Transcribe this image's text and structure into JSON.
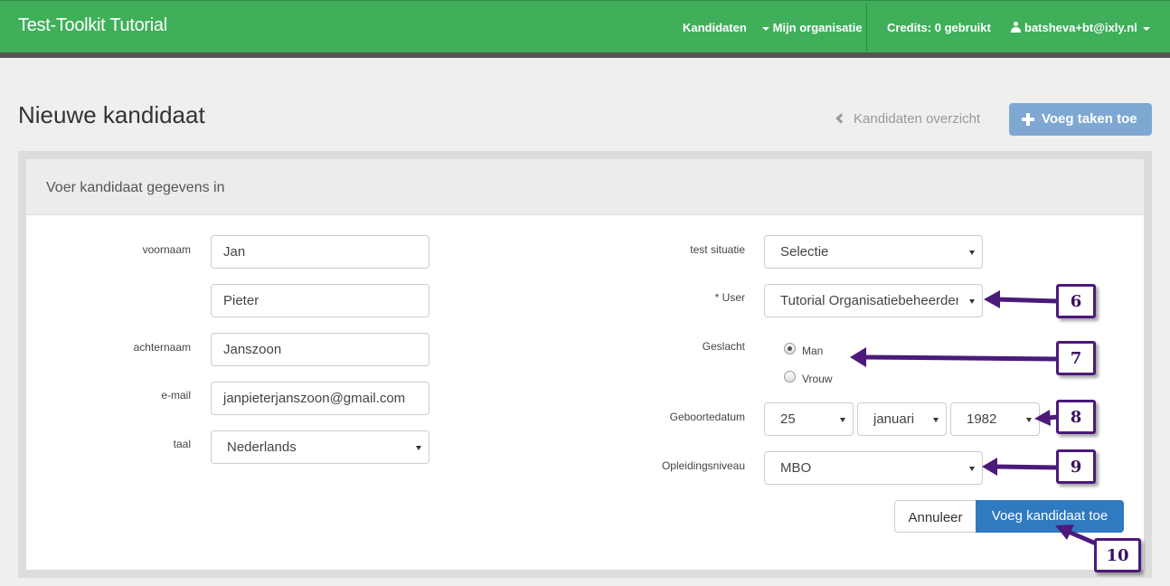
{
  "navbar": {
    "brand": "Test-Toolkit Tutorial",
    "kandidaten": "Kandidaten",
    "mijn_organisatie": "Mijn organisatie",
    "credits": "Credits: 0 gebruikt",
    "user": "batsheva+bt@ixly.nl",
    "color": "#3faf5a"
  },
  "page": {
    "title": "Nieuwe kandidaat",
    "back_link": "Kandidaten overzicht",
    "add_tasks": "Voeg taken toe"
  },
  "panel": {
    "heading": "Voer kandidaat gegevens in"
  },
  "form": {
    "voornaam_label": "voornaam",
    "voornaam": "Jan",
    "tussenvoegsel": "Pieter",
    "achternaam_label": "achternaam",
    "achternaam": "Janszoon",
    "email_label": "e-mail",
    "email": "janpieterjanszoon@gmail.com",
    "taal_label": "taal",
    "taal": "Nederlands",
    "test_situatie_label": "test situatie",
    "test_situatie": "Selectie",
    "user_label": "* User",
    "user": "Tutorial Organisatiebeheerder",
    "geslacht_label": "Geslacht",
    "gender_options": [
      "Man",
      "Vrouw"
    ],
    "gender_selected": "Man",
    "geboortedatum_label": "Geboortedatum",
    "dag": "25",
    "maand": "januari",
    "jaar": "1982",
    "opleidingsniveau_label": "Opleidingsniveau",
    "opleidingsniveau": "MBO",
    "cancel": "Annuleer",
    "submit": "Voeg kandidaat toe"
  },
  "annotations": {
    "items": [
      "6",
      "7",
      "8",
      "9",
      "10"
    ],
    "color": "#4b1a7a"
  }
}
